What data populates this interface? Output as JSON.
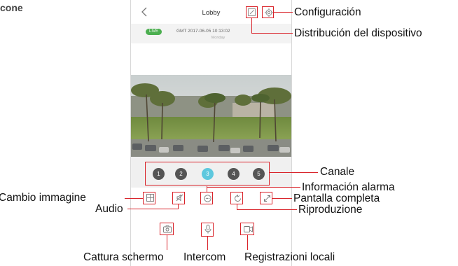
{
  "corner_label": "cone",
  "app": {
    "title": "Lobby",
    "live_badge": "LIVE",
    "timestamp": "GMT 2017-06-05 10:13:02",
    "weekday": "Monday"
  },
  "channels": [
    {
      "label": "1",
      "active": false
    },
    {
      "label": "2",
      "active": false
    },
    {
      "label": "3",
      "active": true
    },
    {
      "label": "4",
      "active": false
    },
    {
      "label": "5",
      "active": false
    }
  ],
  "callouts": {
    "configuracion": "Configuración",
    "distribucion": "Distribución del dispositivo",
    "canale": "Canale",
    "informacion_alarma": "Información alarma",
    "pantalla_completa": "Pantalla completa",
    "riproduzione": "Riproduzione",
    "cambio_immagine": "Cambio immagine",
    "audio": "Audio",
    "cattura_schermo": "Cattura schermo",
    "intercom": "Intercom",
    "registrazioni_locali": "Registrazioni locali"
  },
  "colors": {
    "annotation_red": "#d9232a",
    "live_green": "#4caf50",
    "active_channel": "#5ec8de",
    "channel_gray": "#555555"
  },
  "icons": {
    "back": "chevron-left-icon",
    "edit": "edit-icon",
    "settings": "gear-icon",
    "image_switch": "grid-icon",
    "audio": "mute-icon",
    "alarm": "alarm-info-icon",
    "playback": "replay-icon",
    "fullscreen": "expand-icon",
    "snapshot": "camera-icon",
    "intercom": "microphone-icon",
    "record": "video-record-icon"
  }
}
